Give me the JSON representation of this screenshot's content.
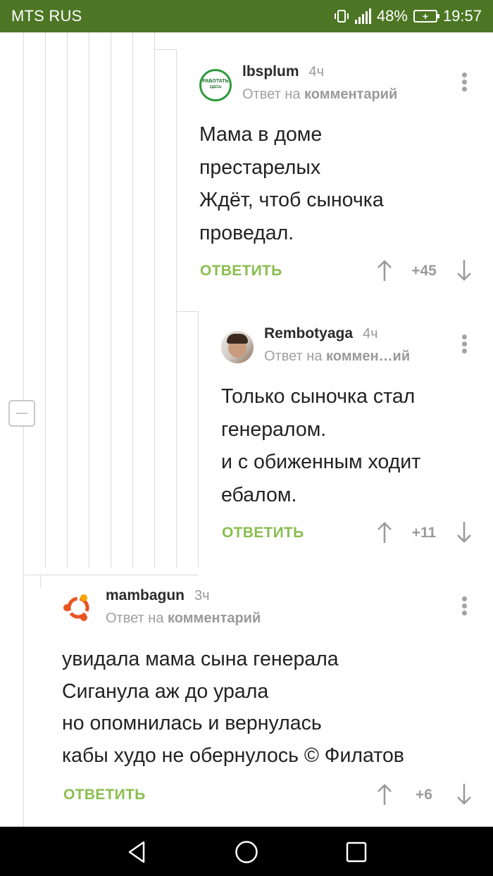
{
  "status_bar": {
    "carrier": "MTS RUS",
    "battery_percent": "48%",
    "time": "19:57"
  },
  "comments": [
    {
      "author": "lbsplum",
      "age": "4ч",
      "reply_prefix": "Ответ на",
      "reply_target": "комментарий",
      "avatar_text_1": "РАБОТАТЬ",
      "avatar_text_2": "ЗДЕСЬ",
      "lines": [
        "Мама в доме",
        "престарелых",
        "Ждёт, чтоб сыночка",
        "проведал."
      ],
      "reply_label": "ОТВЕТИТЬ",
      "rating": "+45"
    },
    {
      "author": "Rembotyaga",
      "age": "4ч",
      "reply_prefix": "Ответ на",
      "reply_target": "коммен…ий",
      "lines": [
        "Только сыночка стал",
        "генералом.",
        "и с обиженным ходит",
        "ебалом."
      ],
      "reply_label": "ОТВЕТИТЬ",
      "rating": "+11"
    },
    {
      "author": "mambagun",
      "age": "3ч",
      "reply_prefix": "Ответ на",
      "reply_target": "комментарий",
      "lines": [
        "увидала мама сына генерала",
        "Сиганула аж до урала",
        "но опомнилась и вернулась",
        "кабы худо не обернулось  © Филатов"
      ],
      "reply_label": "ОТВЕТИТЬ",
      "rating": "+6"
    }
  ],
  "colors": {
    "status_bar": "#4c7624",
    "reply_green": "#8abe4f",
    "thread_line": "#dadada"
  }
}
